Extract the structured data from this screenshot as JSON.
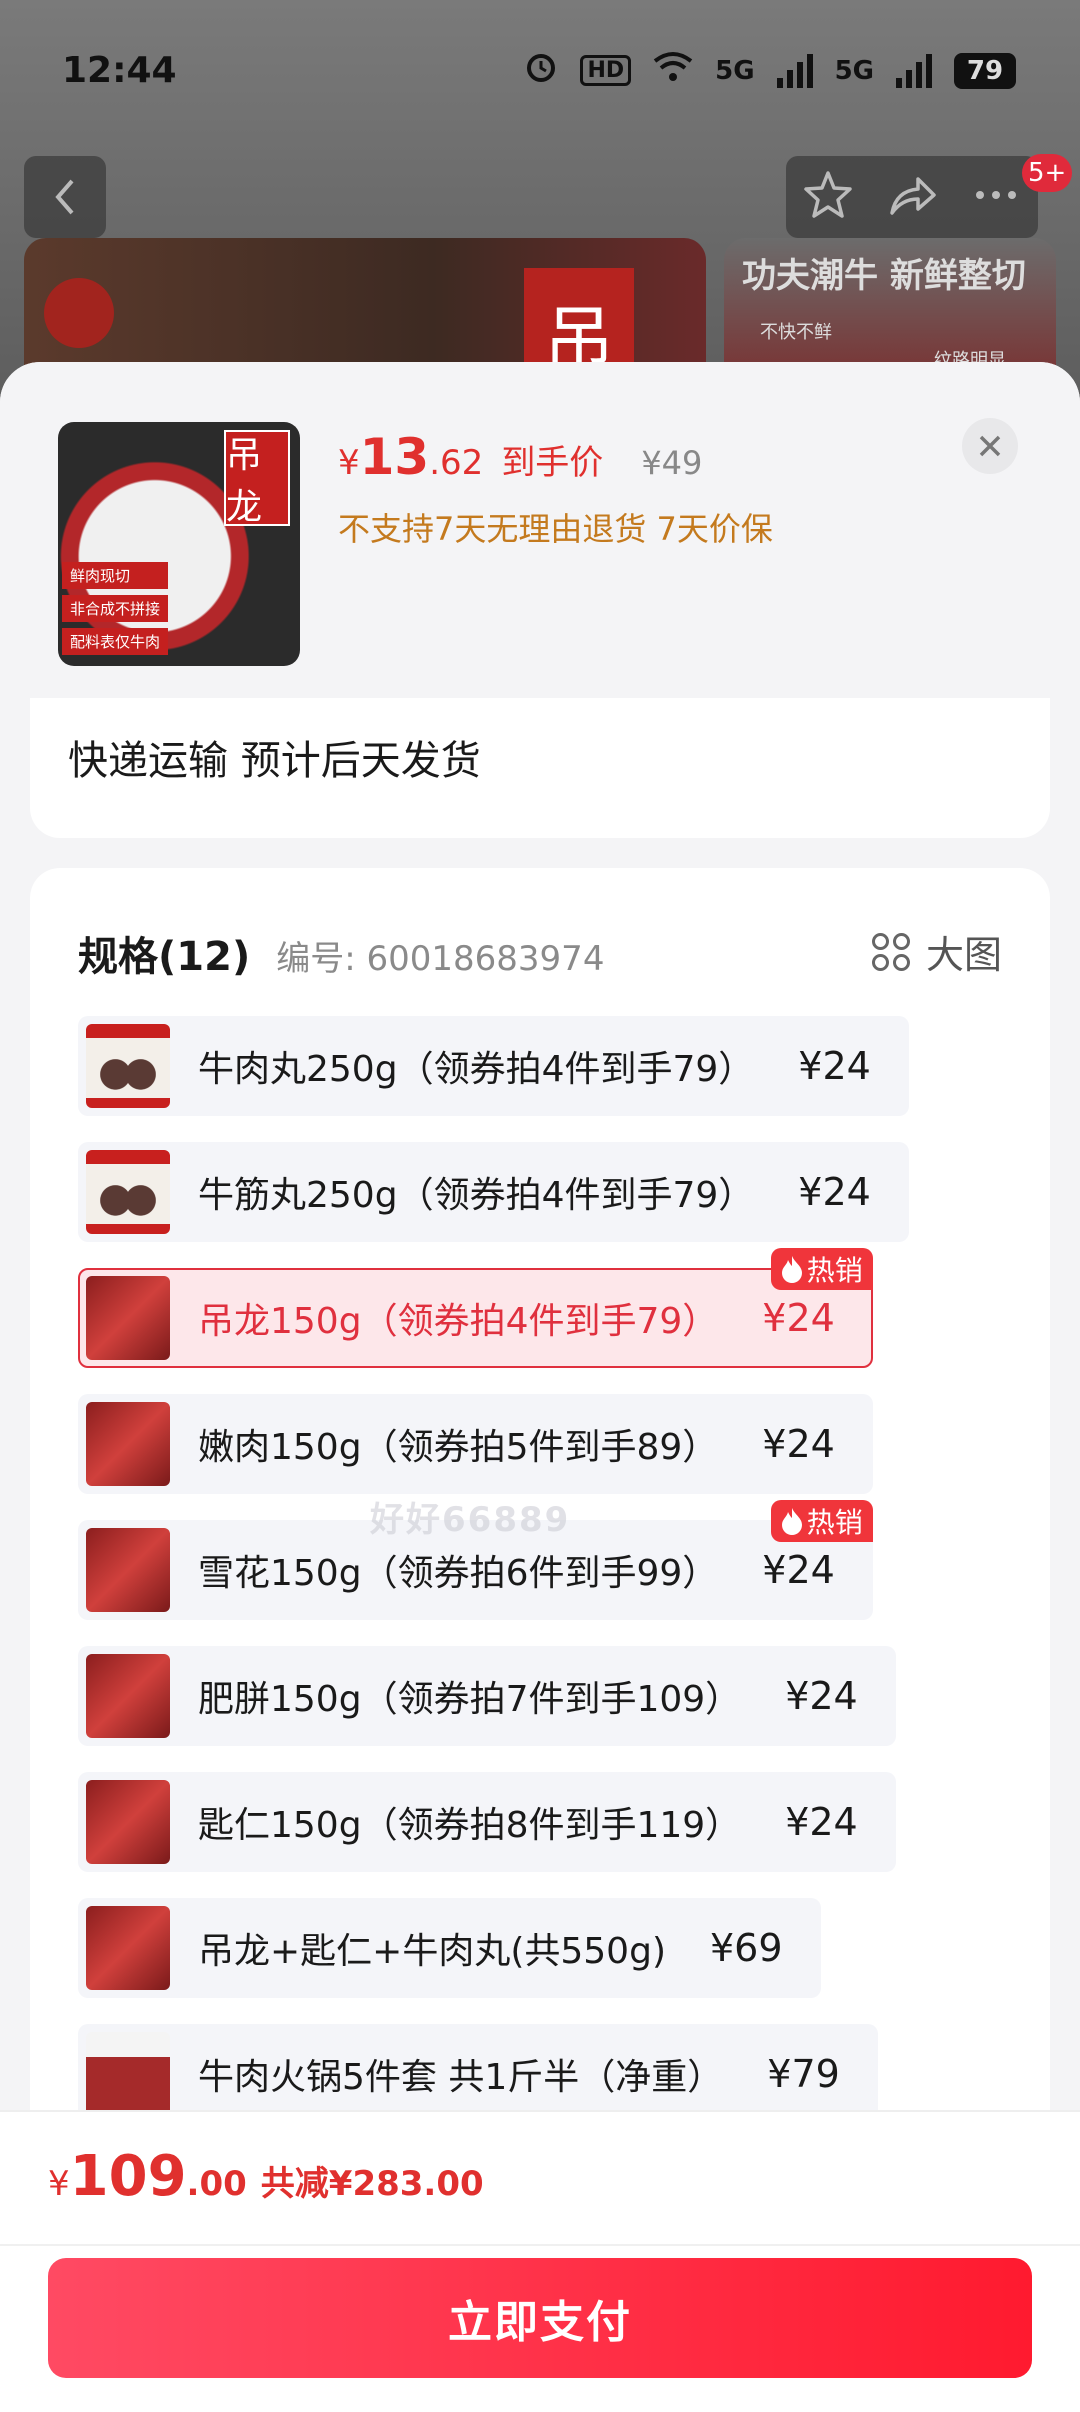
{
  "status_bar": {
    "time": "12:44",
    "battery": "79",
    "hd": "HD",
    "net1": "5G",
    "net2": "5G"
  },
  "background": {
    "notification_count": "5+",
    "banner_logo": "吊",
    "side_banner_title": "功夫潮牛 新鲜整切",
    "side_banner_sub": "不快不鲜",
    "side_banner_sub2": "纹路明显"
  },
  "header": {
    "thumb_flag": "吊龙",
    "thumb_tags": [
      "鲜肉现切",
      "非合成不拼接",
      "配料表仅牛肉"
    ],
    "price_yen": "¥",
    "price_int": "13",
    "price_dec": ".62",
    "price_label": "到手价",
    "original_price": "¥49",
    "notice": "不支持7天无理由退货  7天价保"
  },
  "shipping": {
    "text": "快递运输 预计后天发货"
  },
  "spec": {
    "title": "规格(12)",
    "code": "编号: 60018683974",
    "big_view": "大图",
    "hot_label": "热销",
    "options": [
      {
        "label": "牛肉丸250g（领券拍4件到手79）",
        "price": "¥24"
      },
      {
        "label": "牛筋丸250g（领券拍4件到手79）",
        "price": "¥24"
      },
      {
        "label": "吊龙150g（领券拍4件到手79）",
        "price": "¥24"
      },
      {
        "label": "嫩肉150g（领券拍5件到手89）",
        "price": "¥24"
      },
      {
        "label": "雪花150g（领券拍6件到手99）",
        "price": "¥24"
      },
      {
        "label": "肥胼150g（领券拍7件到手109）",
        "price": "¥24"
      },
      {
        "label": "匙仁150g（领券拍8件到手119）",
        "price": "¥24"
      },
      {
        "label": "吊龙+匙仁+牛肉丸(共550g)",
        "price": "¥69"
      },
      {
        "label": "牛肉火锅5件套 共1斤半（净重）",
        "price": "¥79"
      }
    ],
    "watermark": "好好66889"
  },
  "footer": {
    "yen": "¥",
    "int": "109",
    "dec": ".00",
    "saving": "共减¥283.00",
    "pay_label": "立即支付"
  },
  "colors": {
    "accent": "#e0302e",
    "notice": "#c47a1e",
    "selected_bg": "#fde7ea"
  }
}
